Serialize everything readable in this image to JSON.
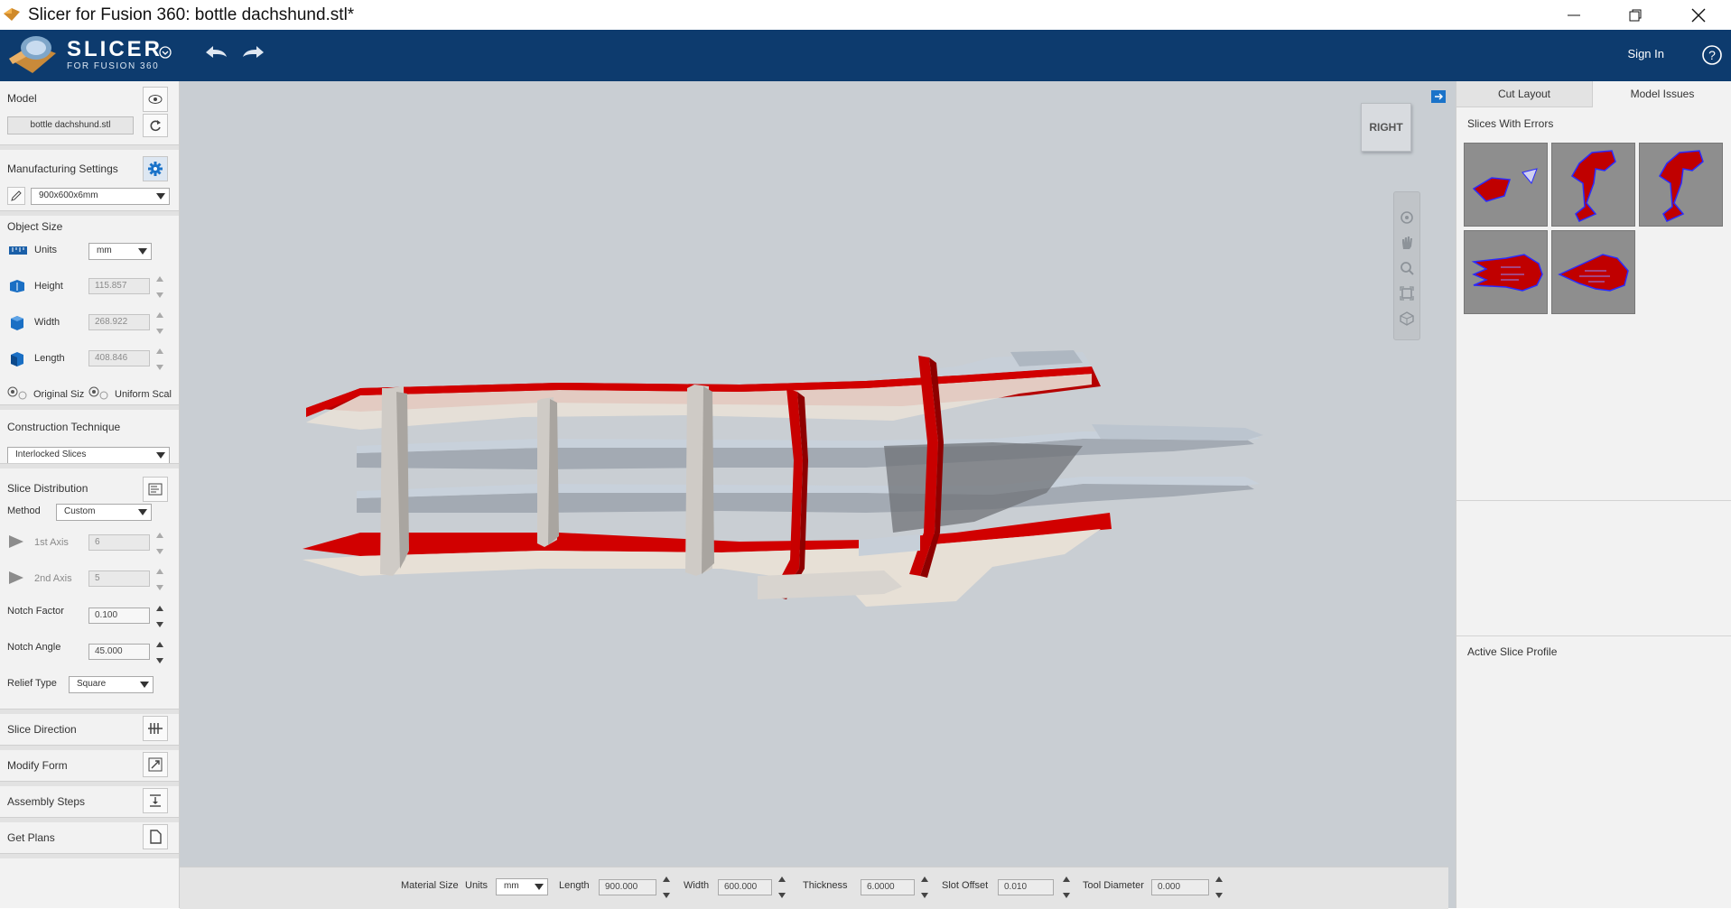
{
  "window": {
    "title": "Slicer for Fusion 360: bottle dachshund.stl*"
  },
  "appbar": {
    "brand": "SLICER",
    "sub": "FOR FUSION 360",
    "signin": "Sign In"
  },
  "left": {
    "model_label": "Model",
    "model_file": "bottle dachshund.stl",
    "mfg_label": "Manufacturing Settings",
    "mfg_value": "900x600x6mm",
    "object_size": "Object Size",
    "units_label": "Units",
    "units_value": "mm",
    "height_label": "Height",
    "height_value": "115.857",
    "width_label": "Width",
    "width_value": "268.922",
    "length_label": "Length",
    "length_value": "408.846",
    "original_size": "Original Siz",
    "uniform_scale": "Uniform Scal",
    "construction_label": "Construction Technique",
    "construction_value": "Interlocked Slices",
    "distribution_label": "Slice Distribution",
    "method_label": "Method",
    "method_value": "Custom",
    "axis1_label": "1st Axis",
    "axis1_value": "6",
    "axis2_label": "2nd Axis",
    "axis2_value": "5",
    "notch_factor_label": "Notch Factor",
    "notch_factor_value": "0.100",
    "notch_angle_label": "Notch Angle",
    "notch_angle_value": "45.000",
    "relief_label": "Relief Type",
    "relief_value": "Square",
    "slice_direction": "Slice Direction",
    "modify_form": "Modify Form",
    "assembly_steps": "Assembly Steps",
    "get_plans": "Get Plans"
  },
  "viewport": {
    "view_cube": "RIGHT"
  },
  "right": {
    "tab_cut": "Cut Layout",
    "tab_issues": "Model Issues",
    "errors_title": "Slices With Errors",
    "profile_title": "Active Slice Profile"
  },
  "bottom": {
    "material_size": "Material Size",
    "units_label": "Units",
    "units_value": "mm",
    "length_label": "Length",
    "length_value": "900.000",
    "width_label": "Width",
    "width_value": "600.000",
    "thickness_label": "Thickness",
    "thickness_value": "6.0000",
    "slot_label": "Slot Offset",
    "slot_value": "0.010",
    "tool_label": "Tool Diameter",
    "tool_value": "0.000"
  },
  "colors": {
    "appbar": "#0d3b6e",
    "error_red": "#cc0000",
    "viewport_bg": "#c9ced3"
  },
  "icons": [
    "app-icon",
    "undo-icon",
    "redo-icon",
    "help-icon",
    "eye-icon",
    "refresh-icon",
    "gear-icon",
    "pencil-icon",
    "orbit-icon",
    "pan-icon",
    "zoom-icon",
    "fit-icon",
    "home-icon"
  ]
}
